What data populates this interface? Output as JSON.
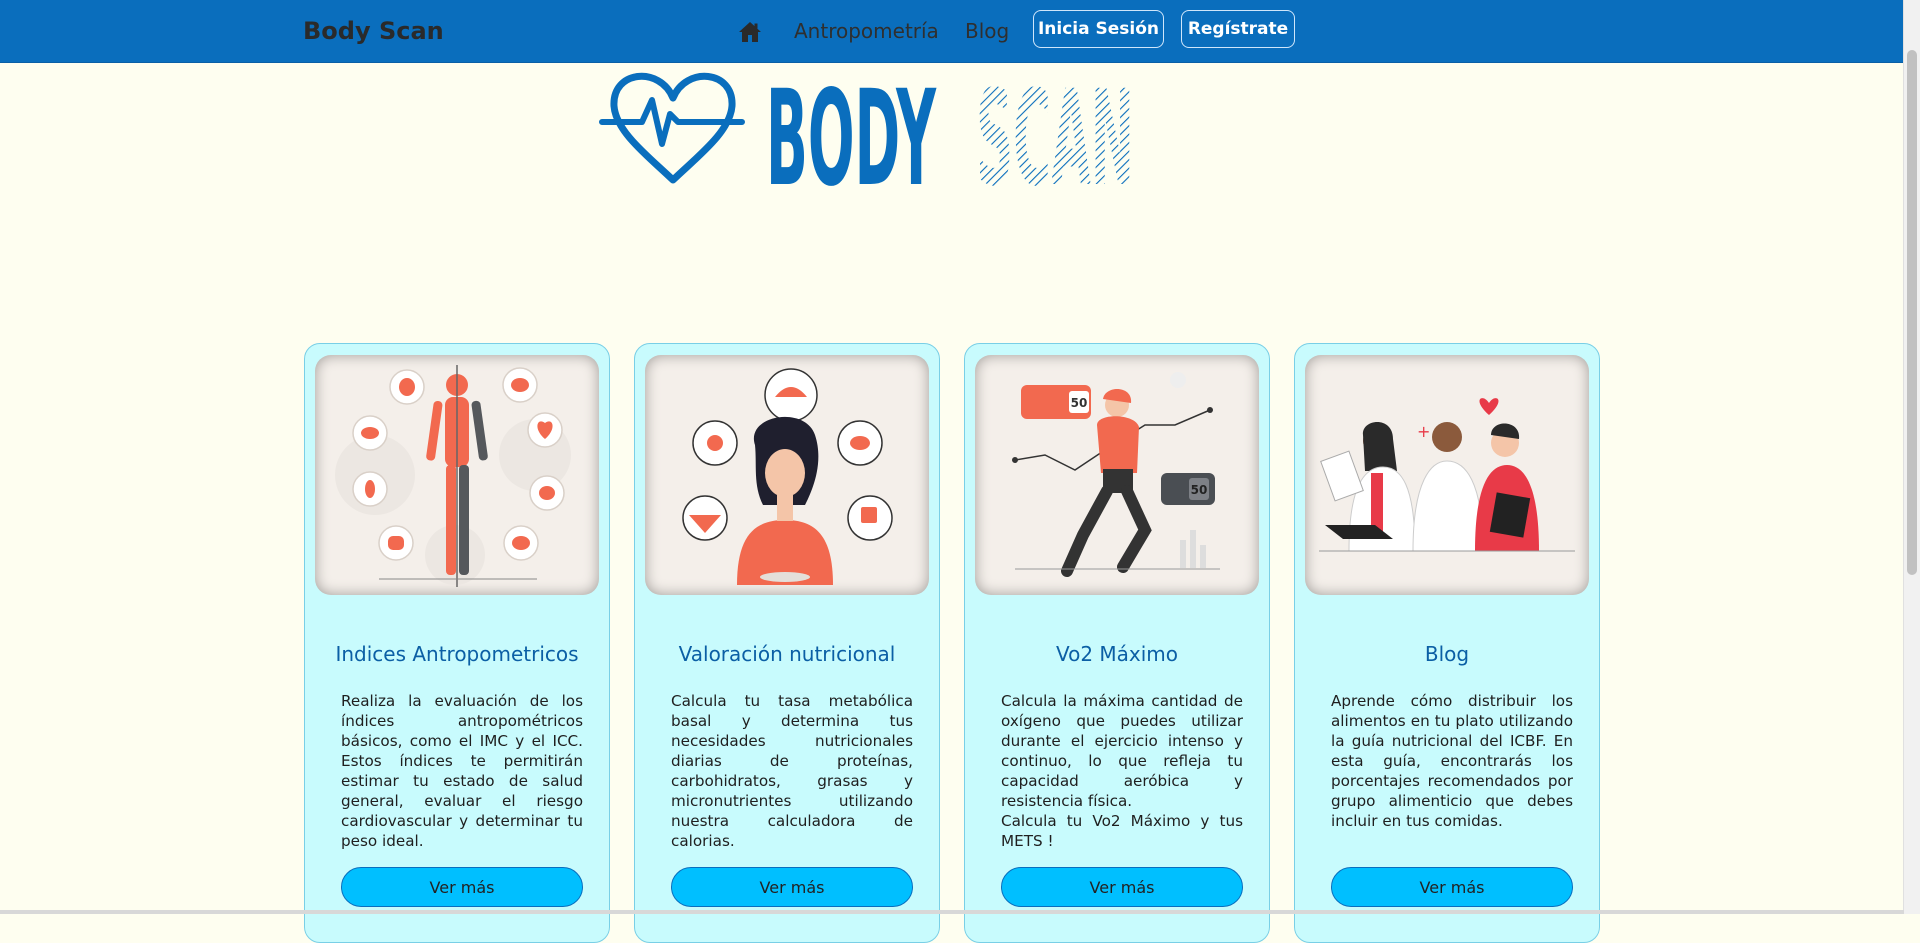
{
  "navbar": {
    "brand": "Body Scan",
    "home_icon": "home-icon",
    "links": [
      "Antropometría",
      "Blog"
    ],
    "login_label": "Inicia Sesión",
    "register_label": "Regístrate"
  },
  "logo": {
    "part1": "BODY",
    "part2": "SCAN",
    "icon": "heartbeat-heart-icon"
  },
  "colors": {
    "navbar": "#0A6EBD",
    "background": "#FEFEF0",
    "card_bg": "#C8FBFD",
    "card_title": "#0B5FA5",
    "button": "#00BFFF"
  },
  "cards": [
    {
      "title": "Indices Antropometricos",
      "text": [
        "Realiza la evaluación de los índices antropométricos básicos, como el IMC y el ICC. Estos índices te permitirán estimar tu estado de salud general, evaluar el riesgo cardiovascular y determinar tu peso ideal."
      ],
      "button": "Ver más",
      "image": "human-anatomy-illustration"
    },
    {
      "title": "Valoración nutricional",
      "text": [
        "Calcula tu tasa metabólica basal y determina tus necesidades nutricionales diarias de proteínas, carbohidratos, grasas y micronutrientes utilizando nuestra calculadora de calorias."
      ],
      "button": "Ver más",
      "image": "nutrition-person-illustration"
    },
    {
      "title": "Vo2 Máximo",
      "text": [
        "Calcula la máxima cantidad de oxígeno que puedes utilizar durante el ejercicio intenso y continuo, lo que refleja tu capacidad aeróbica y resistencia física.",
        "Calcula tu Vo2 Máximo y tus METS !"
      ],
      "button": "Ver más",
      "image": "runner-illustration",
      "badges": [
        "50",
        "50"
      ]
    },
    {
      "title": "Blog",
      "text": [
        "Aprende cómo distribuir los alimentos en tu plato utilizando la guía nutricional del ICBF. En esta guía, encontrarás los porcentajes recomendados por grupo alimenticio que debes incluir en tus comidas."
      ],
      "button": "Ver más",
      "image": "medical-team-illustration"
    }
  ]
}
